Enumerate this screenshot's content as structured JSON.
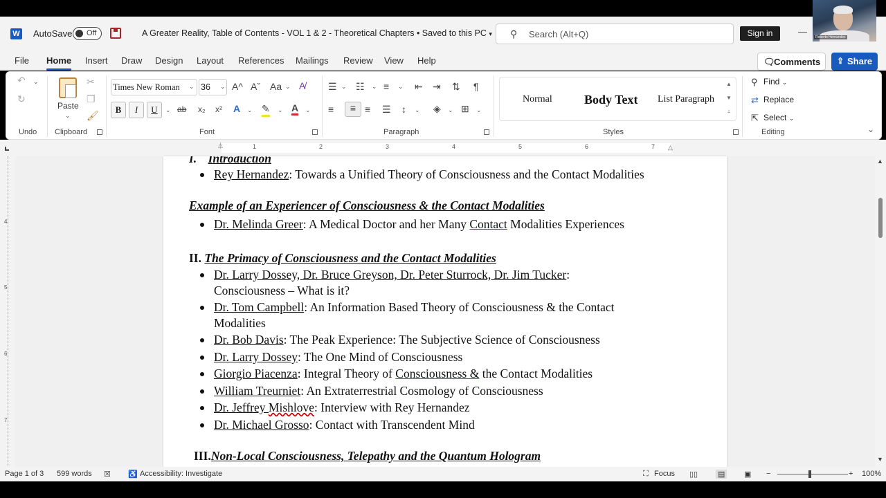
{
  "titlebar": {
    "app_logo": "W",
    "autosave_label": "AutoSave",
    "autosave_state": "Off",
    "document_title": "A Greater Reality, Table of Contents - VOL 1 & 2 - Theoretical Chapters • Saved to this PC",
    "search_placeholder": "Search (Alt+Q)",
    "signin_label": "Sign in",
    "minimize_glyph": "—",
    "webcam_name": "Roberto Hernandez"
  },
  "menu": {
    "items": [
      "File",
      "Home",
      "Insert",
      "Draw",
      "Design",
      "Layout",
      "References",
      "Mailings",
      "Review",
      "View",
      "Help"
    ],
    "active": "Home",
    "comments_label": "Comments",
    "share_label": "Share"
  },
  "ribbon": {
    "groups": {
      "undo": "Undo",
      "clipboard": "Clipboard",
      "font": "Font",
      "paragraph": "Paragraph",
      "styles": "Styles",
      "editing": "Editing"
    },
    "paste_label": "Paste",
    "font_name": "Times New Roman",
    "font_size": "36",
    "grow_font": "A^",
    "shrink_font": "Aˇ",
    "change_case": "Aa",
    "bold": "B",
    "italic": "I",
    "underline": "U",
    "strikethrough": "ab",
    "subscript": "x₂",
    "superscript": "x²",
    "styles": [
      "Normal",
      "Body Text",
      "List Paragraph"
    ],
    "find_label": "Find",
    "replace_label": "Replace",
    "select_label": "Select",
    "pilcrow": "¶"
  },
  "ruler": {
    "numbers": [
      "1",
      "2",
      "3",
      "4",
      "5",
      "6",
      "7"
    ],
    "vertical_numbers": [
      "4",
      "5",
      "6",
      "7"
    ]
  },
  "document": {
    "section1_heading_num": "I.",
    "section1_heading": "Introduction",
    "s1_item1_name": "Rey Hernandez",
    "s1_item1_text": ":  Towards a Unified Theory of Consciousness and the Contact Modalities",
    "example_heading": "Example of an Experiencer of Consciousness & the Contact Modalities",
    "ex_item1_name": "Dr. Melinda Greer",
    "ex_item1_text_a": ":  A Medical Doctor and her Many ",
    "ex_item1_text_b": "Contact",
    "ex_item1_text_c": " Modalities Experiences",
    "section2_heading_num": "II.",
    "section2_heading": "The Primacy of Consciousness and the Contact Modalities",
    "s2_item1_name": "Dr. Larry Dossey, Dr. Bruce Greyson, Dr. Peter Sturrock, Dr. Jim Tucker",
    "s2_item1_text": ":",
    "s2_item1_line2": "Consciousness – What is it?",
    "s2_item2_name": "Dr. Tom Campbell",
    "s2_item2_text": ":  An Information Based Theory of Consciousness & the Contact",
    "s2_item2_line2": "Modalities",
    "s2_item3_name": "Dr. Bob Davis",
    "s2_item3_text": ":   The Peak Experience: The Subjective Science of Consciousness",
    "s2_item4_name": "Dr. Larry Dossey",
    "s2_item4_text": ":  The One Mind of Consciousness",
    "s2_item5_name": "Giorgio Piacenza",
    "s2_item5_text_a": ":  Integral Theory of ",
    "s2_item5_text_b": "Consciousness  &",
    "s2_item5_text_c": " the Contact Modalities",
    "s2_item6_name": "William Treurniet",
    "s2_item6_text": ":  An Extraterrestrial Cosmology of Consciousness",
    "s2_item7_name_a": "Dr. Jeffrey ",
    "s2_item7_name_b": "Mishlove",
    "s2_item7_text": ":  Interview with Rey Hernandez",
    "s2_item8_name": "Dr. Michael Grosso",
    "s2_item8_text": ": Contact with Transcendent Mind",
    "section3_heading_num": "III.",
    "section3_heading": "Non-Local Consciousness, Telepathy and the Quantum Hologram"
  },
  "status": {
    "page": "Page 1 of 3",
    "words": "599 words",
    "accessibility": "Accessibility: Investigate",
    "focus": "Focus",
    "zoom_minus": "−",
    "zoom_plus": "+",
    "zoom": "100%",
    "zoom_level": 1.0
  },
  "colors": {
    "accent": "#185abd",
    "chrome": "#f3f3f3",
    "canvas": "#f0f0f0"
  }
}
